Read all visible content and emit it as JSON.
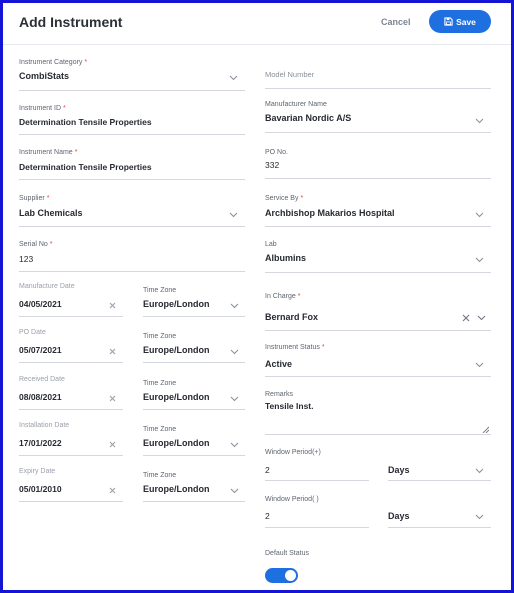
{
  "header": {
    "title": "Add Instrument",
    "cancel_label": "Cancel",
    "save_label": "Save"
  },
  "left": {
    "instrument_category": {
      "label": "Instrument Category",
      "required": "*",
      "value": "CombiStats"
    },
    "instrument_id": {
      "label": "Instrument ID",
      "required": "*",
      "value": "Determination Tensile Properties"
    },
    "instrument_name": {
      "label": "Instrument Name",
      "required": "*",
      "value": "Determination Tensile Properties"
    },
    "supplier": {
      "label": "Supplier",
      "required": "*",
      "value": "Lab Chemicals"
    },
    "serial_no": {
      "label": "Serial No",
      "required": "*",
      "value": "123"
    },
    "dates": [
      {
        "label": "Manufacture Date",
        "value": "04/05/2021",
        "tz_label": "Time Zone",
        "tz_value": "Europe/London"
      },
      {
        "label": "PO Date",
        "value": "05/07/2021",
        "tz_label": "Time Zone",
        "tz_value": "Europe/London"
      },
      {
        "label": "Received Date",
        "value": "08/08/2021",
        "tz_label": "Time Zone",
        "tz_value": "Europe/London"
      },
      {
        "label": "Installation Date",
        "value": "17/01/2022",
        "tz_label": "Time Zone",
        "tz_value": "Europe/London"
      },
      {
        "label": "Expiry Date",
        "value": "05/01/2010",
        "tz_label": "Time Zone",
        "tz_value": "Europe/London"
      }
    ]
  },
  "right": {
    "model_number": {
      "placeholder": "Model Number"
    },
    "manufacturer_name": {
      "label": "Manufacturer Name",
      "value": "Bavarian Nordic A/S"
    },
    "po_no": {
      "label": "PO No.",
      "value": "332"
    },
    "service_by": {
      "label": "Service By",
      "required": "*",
      "value": "Archbishop Makarios Hospital"
    },
    "lab": {
      "label": "Lab",
      "value": "Albumins"
    },
    "in_charge": {
      "label": "In Charge",
      "required": "*",
      "value": "Bernard Fox"
    },
    "instrument_status": {
      "label": "Instrument Status",
      "required": "*",
      "value": "Active"
    },
    "remarks": {
      "label": "Remarks",
      "value": "Tensile Inst."
    },
    "window_period_plus": {
      "label": "Window Period(+)",
      "value": "2",
      "unit": "Days"
    },
    "window_period_minus": {
      "label": "Window Period( )",
      "value": "2",
      "unit": "Days"
    },
    "default_status": {
      "label": "Default Status",
      "on": true
    }
  },
  "colors": {
    "accent": "#1e6fe0",
    "frame": "#1414d6",
    "required": "#e0453f"
  },
  "icons": [
    "save-icon",
    "chevron-down-icon",
    "clear-icon",
    "resize-grip-icon"
  ]
}
